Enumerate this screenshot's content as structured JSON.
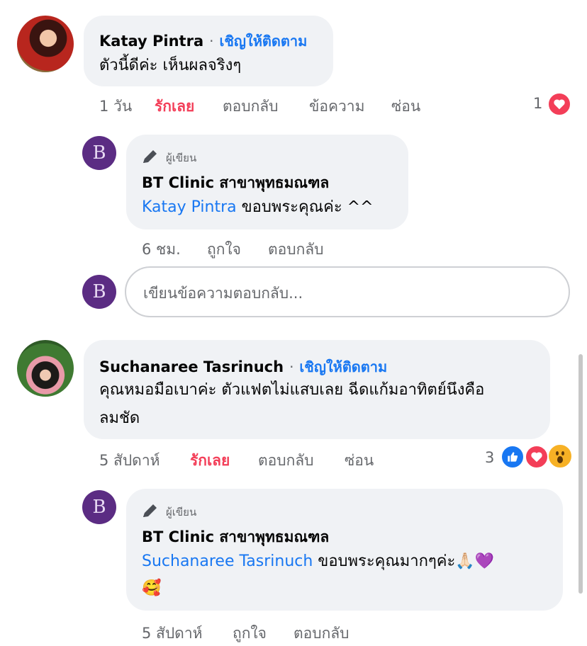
{
  "comments": [
    {
      "author": "Katay Pintra",
      "separator": "·",
      "follow_label": "เชิญให้ติดตาม",
      "text": "ตัวนี้ดีค่ะ เห็นผลจริงๆ",
      "time": "1 วัน",
      "love_label": "รักเลย",
      "reply_label": "ตอบกลับ",
      "message_label": "ข้อความ",
      "hide_label": "ซ่อน",
      "reaction_count": "1",
      "reply": {
        "author_tag": "ผู้เขียน",
        "author": "BT Clinic สาขาพุทธมณฑล",
        "mention": "Katay Pintra",
        "text": " ขอบพระคุณค่ะ ^^",
        "time": "6 ชม.",
        "like_label": "ถูกใจ",
        "reply_label": "ตอบกลับ"
      },
      "reply_input_placeholder": "เขียนข้อความตอบกลับ..."
    },
    {
      "author": "Suchanaree Tasrinuch",
      "separator": "·",
      "follow_label": "เชิญให้ติดตาม",
      "text_line1": "คุณหมอมือเบาค่ะ ตัวแฟตไม่แสบเลย ฉีดแก้มอาทิตย์นึงคือ",
      "text_line2": "ลมชัด",
      "time": "5 สัปดาห์",
      "love_label": "รักเลย",
      "reply_label": "ตอบกลับ",
      "hide_label": "ซ่อน",
      "reaction_count": "3",
      "reply": {
        "author_tag": "ผู้เขียน",
        "author": "BT Clinic สาขาพุทธมณฑล",
        "mention": "Suchanaree Tasrinuch",
        "text": " ขอบพระคุณมากๆค่ะ🙏🏻💜",
        "text_line2": "🥰",
        "time": "5 สัปดาห์",
        "like_label": "ถูกใจ",
        "reply_label": "ตอบกลับ"
      }
    }
  ],
  "logo_text": "B",
  "colors": {
    "link_blue": "#1877f2",
    "love_red": "#f33e58",
    "bubble_bg": "#f0f2f5",
    "meta_gray": "#65676b",
    "brand_purple": "#5b2c83"
  },
  "icons": [
    "pencil-icon",
    "heart-reaction-icon",
    "like-reaction-icon",
    "wow-reaction-icon"
  ]
}
